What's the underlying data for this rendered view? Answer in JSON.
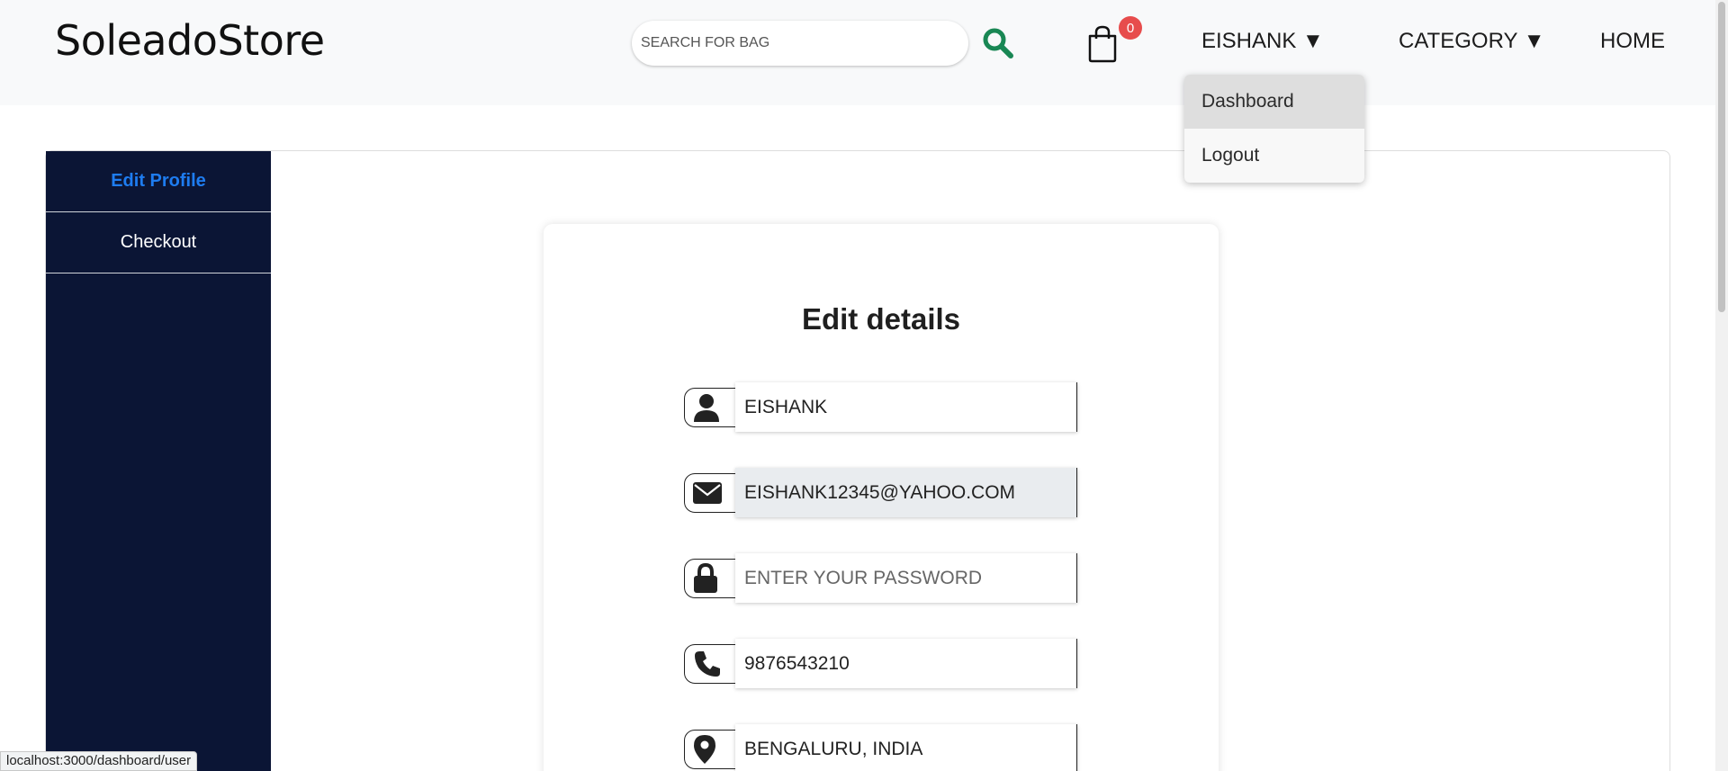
{
  "header": {
    "brand": "SoleadoStore",
    "search_placeholder": "SEARCH FOR BAG",
    "cart_count": "0",
    "nav": {
      "user": "EISHANK ▼",
      "category": "CATEGORY ▼",
      "home": "HOME"
    },
    "accent_color": "#198754"
  },
  "dropdown": {
    "items": [
      "Dashboard",
      "Logout"
    ]
  },
  "sidebar": {
    "items": [
      {
        "label": "Edit Profile",
        "active": true
      },
      {
        "label": "Checkout",
        "active": false
      }
    ],
    "background": "#0b1535"
  },
  "form": {
    "title": "Edit details",
    "fields": [
      {
        "icon": "user-icon",
        "value": "EISHANK",
        "placeholder": ""
      },
      {
        "icon": "envelope-icon",
        "value": "EISHANK12345@YAHOO.COM",
        "placeholder": ""
      },
      {
        "icon": "lock-icon",
        "value": "",
        "placeholder": "ENTER YOUR PASSWORD"
      },
      {
        "icon": "phone-icon",
        "value": "9876543210",
        "placeholder": ""
      },
      {
        "icon": "location-icon",
        "value": "BENGALURU, INDIA",
        "placeholder": ""
      }
    ]
  },
  "status_bar": {
    "url": "localhost:3000/dashboard/user"
  }
}
